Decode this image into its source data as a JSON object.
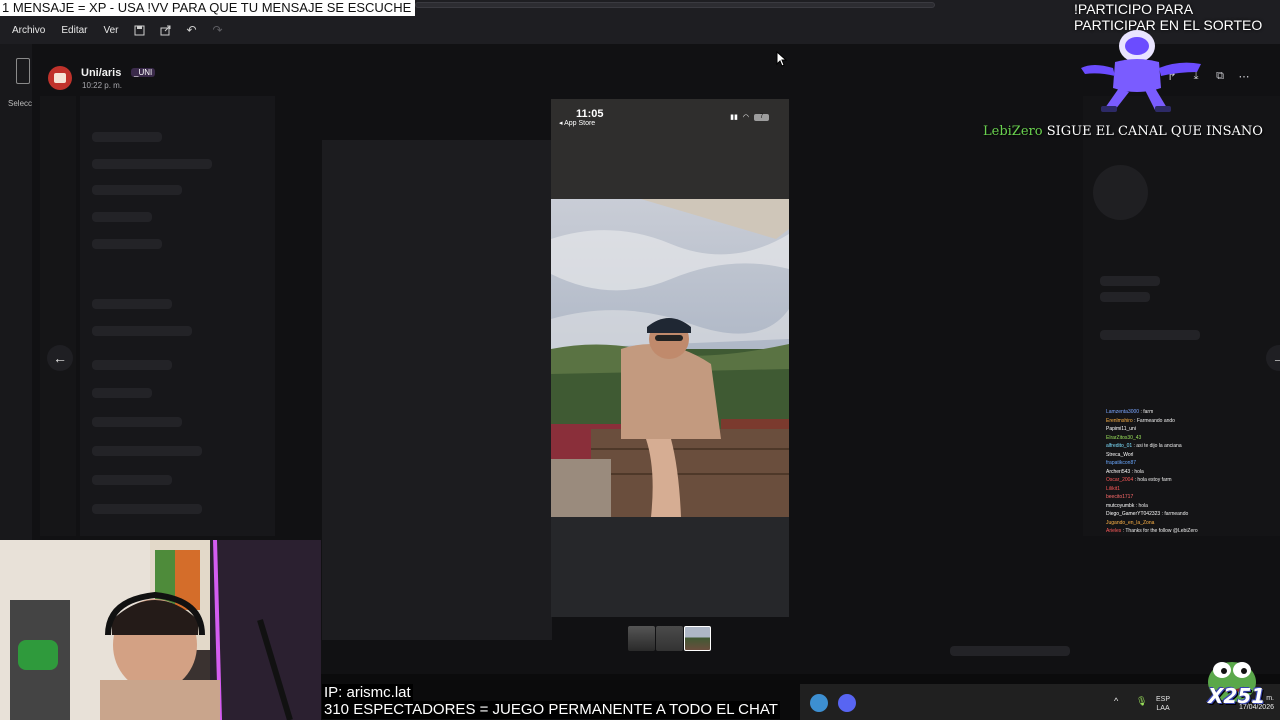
{
  "overlay": {
    "top_message": "1 MENSAJE = XP - USA !VV PARA QUE TU MENSAJE SE ESCUCHE",
    "sorteo_line1": "!PARTICIPO PARA",
    "sorteo_line2": "PARTICIPAR EN EL SORTEO",
    "follow_name": "LebiZero",
    "follow_text": "SIGUE EL CANAL QUE INSANO",
    "ip_text": "IP: arismc.lat",
    "viewers_text": "310 ESPECTADORES = JUEGO PERMANENTE A TODO EL CHAT",
    "badge_count": "X251"
  },
  "menubar": {
    "items": [
      "Archivo",
      "Editar",
      "Ver"
    ],
    "tool_icons": [
      "save-icon",
      "share-icon",
      "undo-icon",
      "redo-icon"
    ]
  },
  "left_rail": {
    "label": "Selecc"
  },
  "viewer": {
    "user_name": "Uni/aris",
    "user_tag": "_UNI",
    "timestamp": "10:22 p. m.",
    "header_icons": [
      "zoom-icon",
      "forward-icon",
      "download-icon",
      "open-external-icon",
      "more-icon"
    ],
    "prev_label": "←",
    "next_label": "→"
  },
  "phone": {
    "time": "11:05",
    "back_label": "◂ App Store",
    "battery": "7"
  },
  "chat": [
    {
      "user": "Lamzenta3000",
      "msg": "farm",
      "color": "#7aa6ff"
    },
    {
      "user": "Erenlmshiro",
      "msg": "Farmeando ando",
      "color": "#ffb347"
    },
    {
      "user": "Papimi11_uni",
      "msg": "",
      "color": "#ffffff"
    },
    {
      "user": "ElrarZitos30_43",
      "msg": "",
      "color": "#9be35b"
    },
    {
      "user": "alfredito_01",
      "msg": "asi te dijo la anciana",
      "color": "#7ee0ff"
    },
    {
      "user": "Streca_Worl",
      "msg": "",
      "color": "#ffffff"
    },
    {
      "user": "frapatikcon87",
      "msg": "",
      "color": "#6aa8ff"
    },
    {
      "user": "Archeri543",
      "msg": "hola",
      "color": "#ffffff"
    },
    {
      "user": "Oscar_2004",
      "msg": "hola estoy farm",
      "color": "#ff5a5a"
    },
    {
      "user": "Lilikit1",
      "msg": "",
      "color": "#ff5a5a"
    },
    {
      "user": "beecito1717",
      "msg": "",
      "color": "#ff6b6b"
    },
    {
      "user": "mutcoyumbk",
      "msg": "hola",
      "color": "#ffffff"
    },
    {
      "user": "Diego_GamerYT042323",
      "msg": "farmeando",
      "color": "#ffffff"
    },
    {
      "user": "Jugando_en_la_Zona",
      "msg": "",
      "color": "#ffb347"
    },
    {
      "user": "Arieles",
      "msg": "Thanks for the follow @LebiZero",
      "color": "#ff5a5a"
    }
  ],
  "tray": {
    "lang_line1": "ESP",
    "lang_line2": "LAA",
    "date": "17/04/2026",
    "time_suffix": "m."
  },
  "colors": {
    "follow_name": "#6ad24f",
    "discord_bg": "#111113",
    "user_avatar": "#c0322b"
  }
}
